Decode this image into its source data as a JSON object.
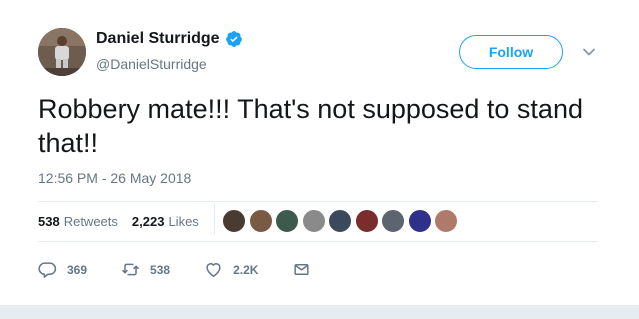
{
  "user": {
    "display_name": "Daniel Sturridge",
    "handle": "@DanielSturridge",
    "verified": true
  },
  "follow_label": "Follow",
  "tweet": {
    "text": "Robbery mate!!! That's not supposed to stand that!!",
    "timestamp": "12:56 PM - 26 May 2018"
  },
  "stats": {
    "retweets_count": "538",
    "retweets_label": "Retweets",
    "likes_count": "2,223",
    "likes_label": "Likes"
  },
  "likers": [
    {
      "color": "#4a3b32"
    },
    {
      "color": "#7a5a44"
    },
    {
      "color": "#3e5a4e"
    },
    {
      "color": "#8a8a8a"
    },
    {
      "color": "#3a4a5c"
    },
    {
      "color": "#7b2d2d"
    },
    {
      "color": "#5c6470"
    },
    {
      "color": "#2f2f8c"
    },
    {
      "color": "#b07a6a"
    }
  ],
  "actions": {
    "reply_count": "369",
    "retweet_count": "538",
    "like_count": "2.2K"
  },
  "colors": {
    "accent": "#1da1f2",
    "secondary_text": "#657786"
  }
}
